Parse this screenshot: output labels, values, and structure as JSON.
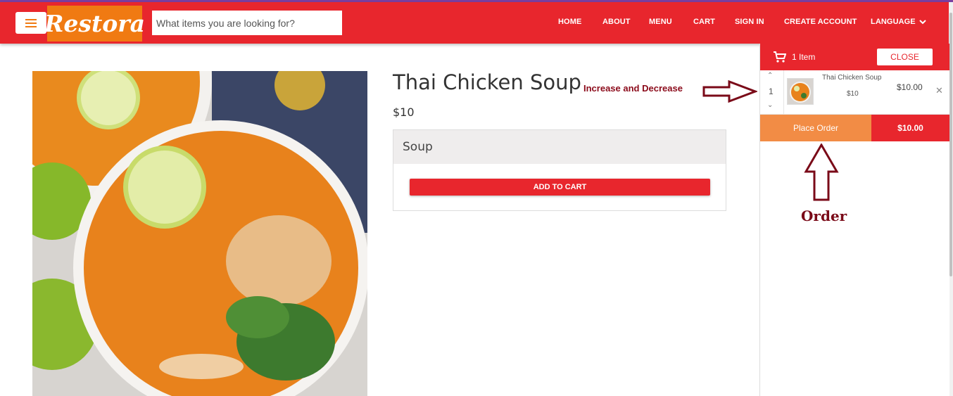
{
  "header": {
    "logo_text": "Restora",
    "search_placeholder": "What items you are looking for?",
    "nav": [
      "HOME",
      "ABOUT",
      "MENU",
      "CART",
      "SIGN IN",
      "CREATE ACCOUNT",
      "LANGUAGE"
    ]
  },
  "product": {
    "title": "Thai Chicken Soup",
    "price": "$10",
    "category": "Soup",
    "add_to_cart_label": "ADD TO CART"
  },
  "annotations": {
    "qty_note": "Increase and Decrease",
    "order_note": "Order"
  },
  "cart": {
    "item_count_label": "1 Item",
    "close_label": "CLOSE",
    "items": [
      {
        "quantity": "1",
        "name": "Thai Chicken Soup",
        "unit_price": "$10",
        "total": "$10.00"
      }
    ],
    "place_order_label": "Place Order",
    "grand_total": "$10.00"
  },
  "colors": {
    "brand_red": "#e8262d",
    "logo_orange": "#f07a12",
    "place_order_orange": "#f28c45",
    "annotation_red": "#8b0a1a"
  }
}
